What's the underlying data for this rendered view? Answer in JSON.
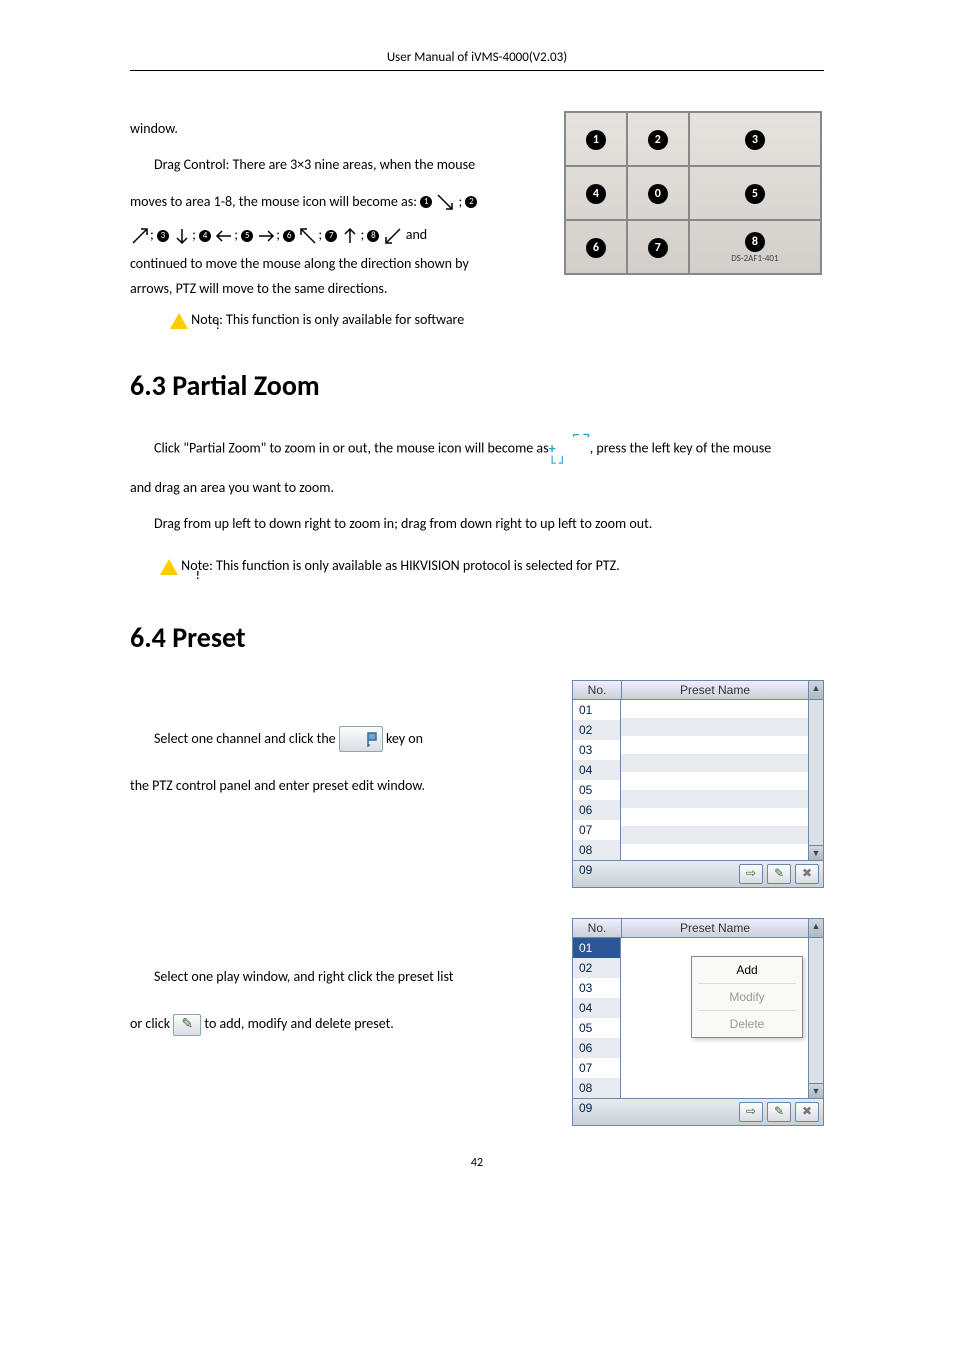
{
  "header": "User Manual of iVMS-4000(V2.03)",
  "para_window": "window.",
  "para_drag": "Drag Control: There are 3×3 nine areas, when the mouse",
  "para_moves_a": "moves to area 1-8, the mouse icon will become as: ",
  "para_moves_b": "; ",
  "arrows_tail": " and",
  "para_cont_a": "continued to move the mouse along the direction shown by",
  "para_cont_b": "arrows, PTZ will move to the same directions.",
  "note1": "Note: This function is only available for software",
  "grid": {
    "cell8_label": "DS-2AF1-401"
  },
  "sec63": {
    "heading": "6.3 Partial Zoom",
    "p1a": "Click \"Partial Zoom\" to zoom in or out, the mouse icon will become as",
    "p1b": ", press the left key of the mouse",
    "p2": "and drag an area you want to zoom.",
    "p3": "Drag from up left to down right to zoom in; drag from down right to up left to zoom out.",
    "note": " Note: This function is only available as HIKVISION protocol is selected for PTZ."
  },
  "sec64": {
    "heading": "6.4 Preset",
    "p1a": "Select one channel and click the ",
    "p1b": " key on",
    "p2": "the PTZ control panel and enter preset edit window.",
    "p3": "Select one play window, and right click the preset list",
    "p4a": "or click ",
    "p4b": " to add, modify and delete preset."
  },
  "preset_table": {
    "col_no": "No.",
    "col_name": "Preset Name",
    "rows": [
      "01",
      "02",
      "03",
      "04",
      "05",
      "06",
      "07",
      "08",
      "09"
    ]
  },
  "context_menu": {
    "add": "Add",
    "modify": "Modify",
    "delete": "Delete"
  },
  "footer_icons": {
    "goto": "⇨",
    "edit": "✎",
    "del": "✖"
  },
  "page_number": "42"
}
